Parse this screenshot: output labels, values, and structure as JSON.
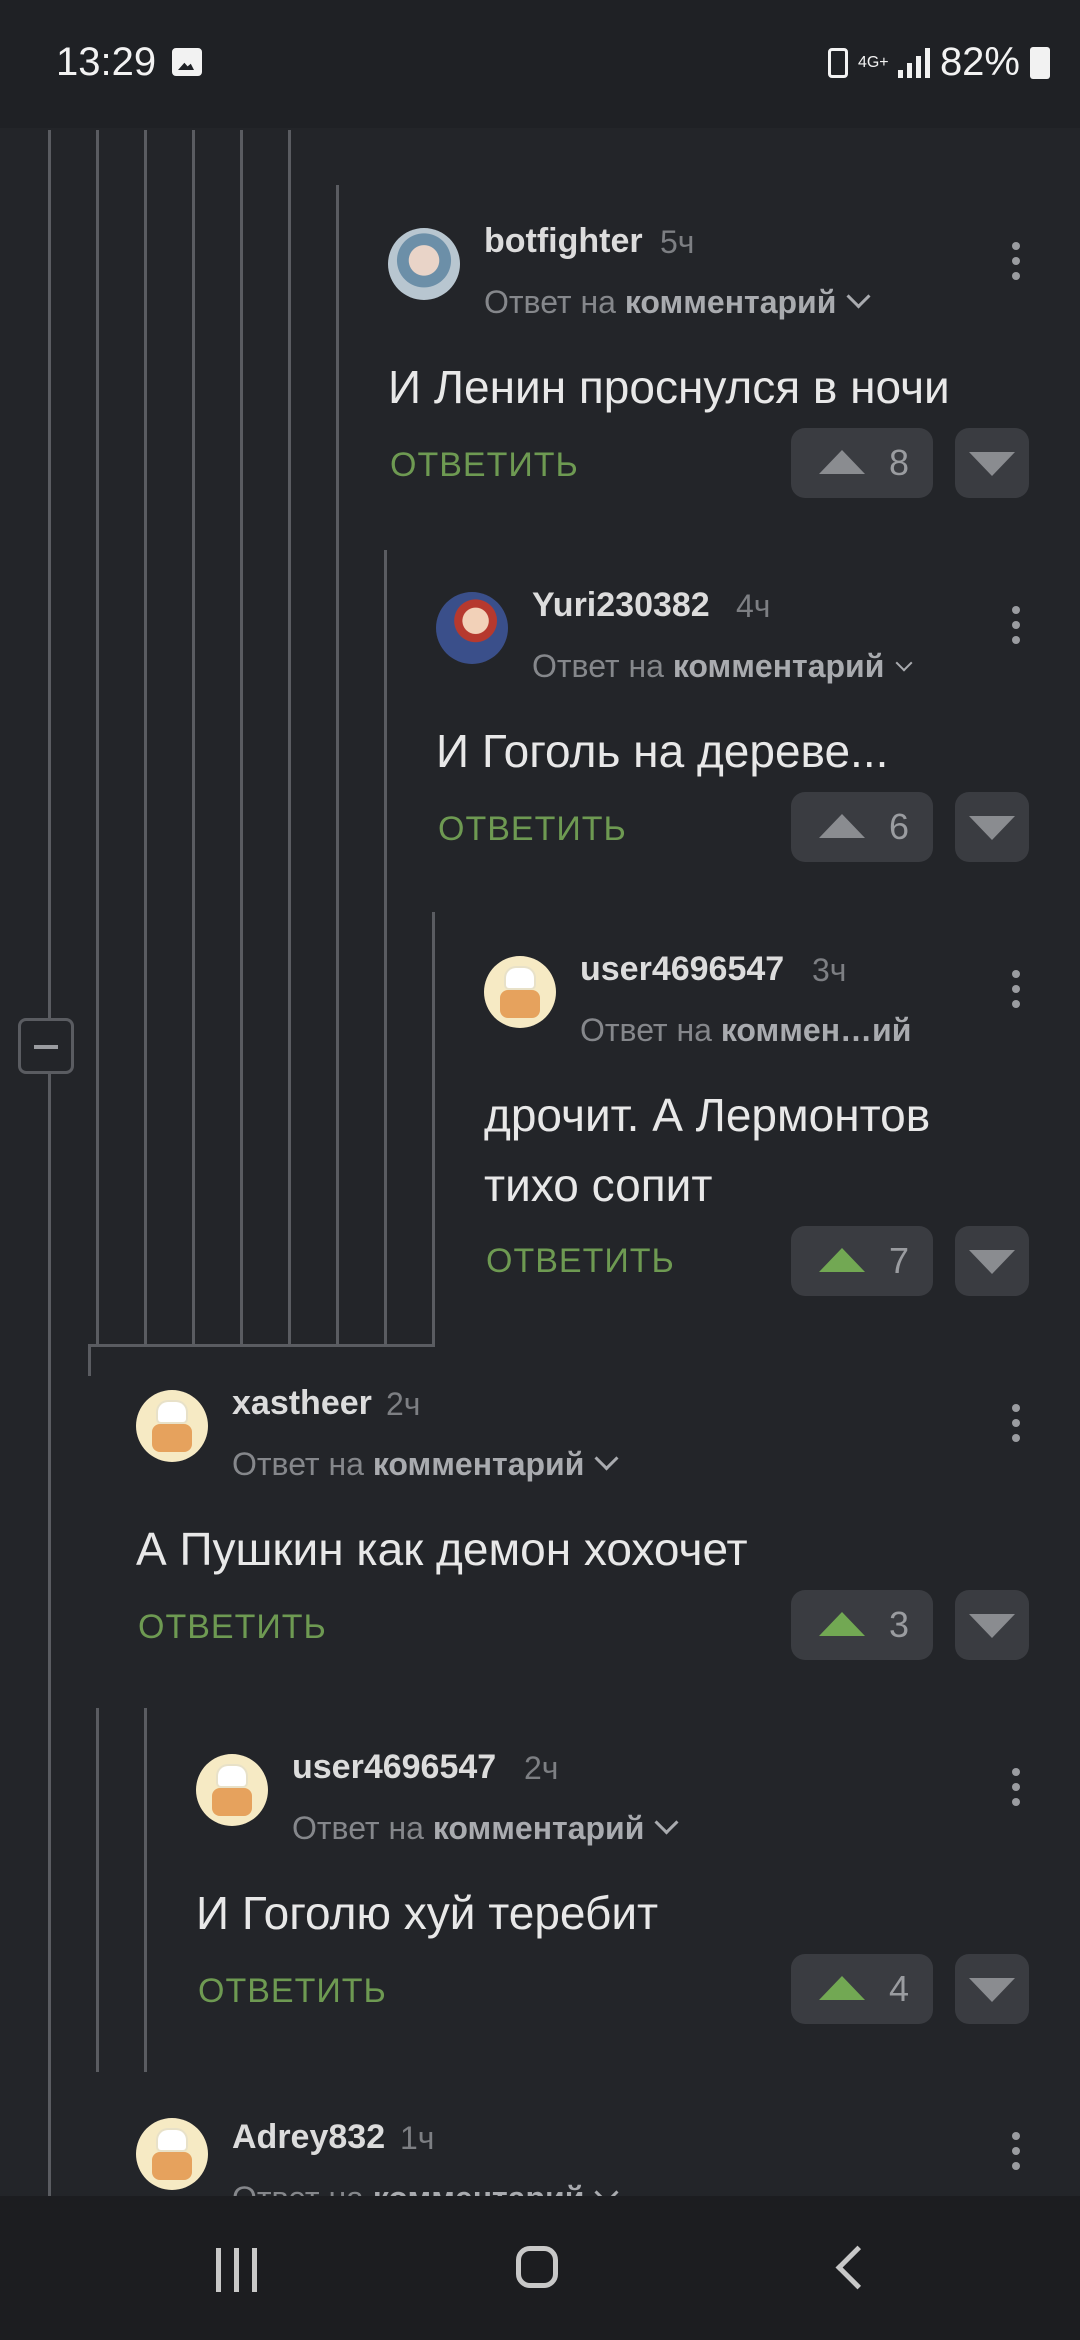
{
  "status_bar": {
    "time": "13:29",
    "network": "4G+",
    "battery": "82%"
  },
  "comments": [
    {
      "author": "botfighter",
      "time": "5ч",
      "reply_prefix": "Ответ на",
      "reply_target": "комментарий",
      "text": "И Ленин проснулся в ночи",
      "reply_label": "ОТВЕТИТЬ",
      "votes": "8"
    },
    {
      "author": "Yuri230382",
      "time": "4ч",
      "reply_prefix": "Ответ на",
      "reply_target": "комментарий",
      "text": "И Гоголь на дереве...",
      "reply_label": "ОТВЕТИТЬ",
      "votes": "6"
    },
    {
      "author": "user4696547",
      "time": "3ч",
      "reply_prefix": "Ответ на",
      "reply_target": "коммен…ий",
      "text": "дрочит. А Лермонтов тихо сопит",
      "reply_label": "ОТВЕТИТЬ",
      "votes": "7"
    },
    {
      "author": "xastheer",
      "time": "2ч",
      "reply_prefix": "Ответ на",
      "reply_target": "комментарий",
      "text": "А Пушкин как демон хохочет",
      "reply_label": "ОТВЕТИТЬ",
      "votes": "3"
    },
    {
      "author": "user4696547",
      "time": "2ч",
      "reply_prefix": "Ответ на",
      "reply_target": "комментарий",
      "text": "И Гоголю хуй теребит",
      "reply_label": "ОТВЕТИТЬ",
      "votes": "4"
    },
    {
      "author": "Adrey832",
      "time": "1ч",
      "reply_prefix": "Ответ на",
      "reply_target": "комментарий"
    }
  ]
}
